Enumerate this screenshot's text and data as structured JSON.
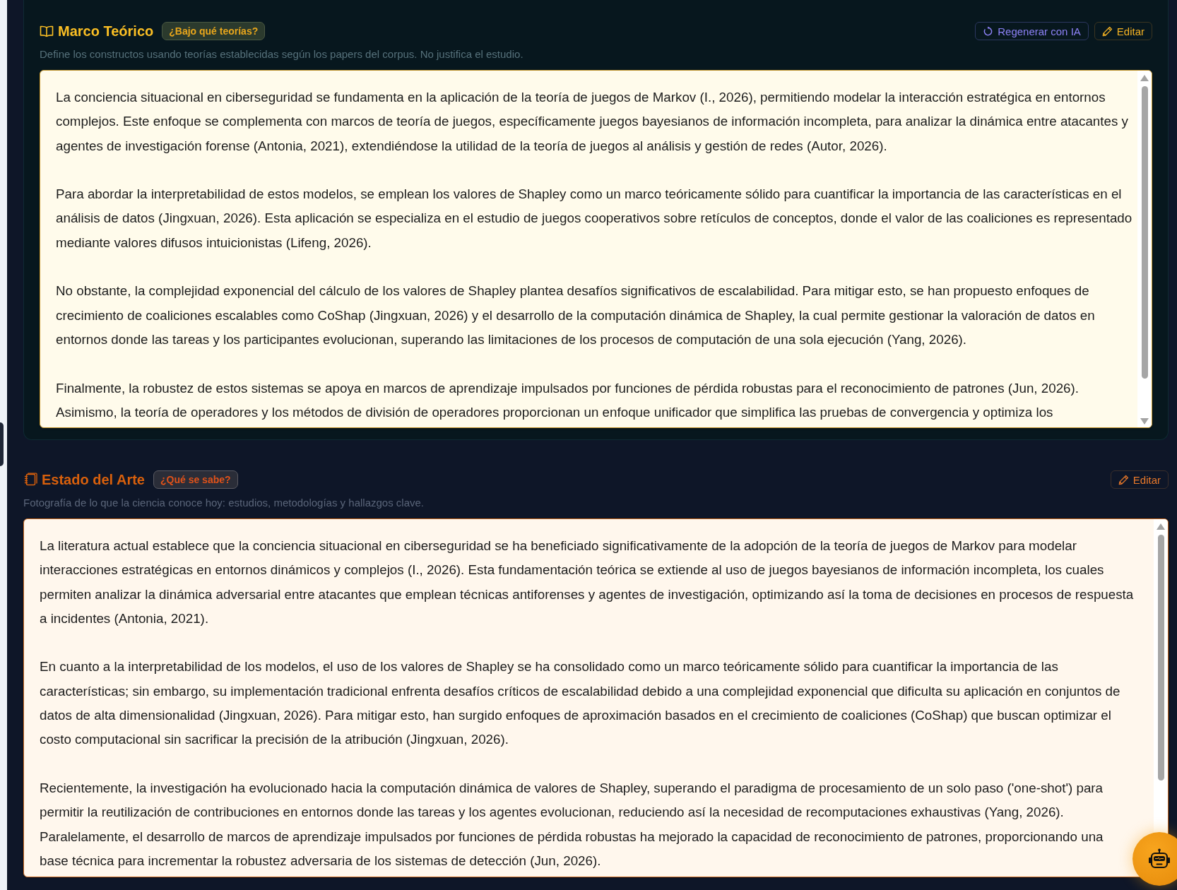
{
  "sections": [
    {
      "kind": "framework",
      "title": "Marco Teórico",
      "badge": "¿Bajo qué teorías?",
      "description": "Define los constructos usando teorías establecidas según los papers del corpus. No justifica el estudio.",
      "actions": [
        {
          "kind": "regenerate",
          "label": "Regenerar con IA"
        },
        {
          "kind": "edit",
          "label": "Editar"
        }
      ],
      "paragraphs": [
        "La conciencia situacional en ciberseguridad se fundamenta en la aplicación de la teoría de juegos de Markov (I., 2026), permitiendo modelar la interacción estratégica en entornos complejos. Este enfoque se complementa con marcos de teoría de juegos, específicamente juegos bayesianos de información incompleta, para analizar la dinámica entre atacantes y agentes de investigación forense (Antonia, 2021), extendiéndose la utilidad de la teoría de juegos al análisis y gestión de redes (Autor, 2026).",
        "Para abordar la interpretabilidad de estos modelos, se emplean los valores de Shapley como un marco teóricamente sólido para cuantificar la importancia de las características en el análisis de datos (Jingxuan, 2026). Esta aplicación se especializa en el estudio de juegos cooperativos sobre retículos de conceptos, donde el valor de las coaliciones es representado mediante valores difusos intuicionistas (Lifeng, 2026).",
        "No obstante, la complejidad exponencial del cálculo de los valores de Shapley plantea desafíos significativos de escalabilidad. Para mitigar esto, se han propuesto enfoques de crecimiento de coaliciones escalables como CoShap (Jingxuan, 2026) y el desarrollo de la computación dinámica de Shapley, la cual permite gestionar la valoración de datos en entornos donde las tareas y los participantes evolucionan, superando las limitaciones de los procesos de computación de una sola ejecución (Yang, 2026).",
        "Finalmente, la robustez de estos sistemas se apoya en marcos de aprendizaje impulsados por funciones de pérdida robustas para el reconocimiento de patrones (Jun, 2026). Asimismo, la teoría de operadores y los métodos de división de operadores proporcionan un enfoque unificador que simplifica las pruebas de convergencia y optimiza los"
      ]
    },
    {
      "kind": "review",
      "title": "Estado del Arte",
      "badge": "¿Qué se sabe?",
      "description": "Fotografía de lo que la ciencia conoce hoy: estudios, metodologías y hallazgos clave.",
      "actions": [
        {
          "kind": "edit",
          "label": "Editar"
        }
      ],
      "paragraphs": [
        "La literatura actual establece que la conciencia situacional en ciberseguridad se ha beneficiado significativamente de la adopción de la teoría de juegos de Markov para modelar interacciones estratégicas en entornos dinámicos y complejos (I., 2026). Esta fundamentación teórica se extiende al uso de juegos bayesianos de información incompleta, los cuales permiten analizar la dinámica adversarial entre atacantes que emplean técnicas antiforenses y agentes de investigación, optimizando así la toma de decisiones en procesos de respuesta a incidentes (Antonia, 2021).",
        "En cuanto a la interpretabilidad de los modelos, el uso de los valores de Shapley se ha consolidado como un marco teóricamente sólido para cuantificar la importancia de las características; sin embargo, su implementación tradicional enfrenta desafíos críticos de escalabilidad debido a una complejidad exponencial que dificulta su aplicación en conjuntos de datos de alta dimensionalidad (Jingxuan, 2026). Para mitigar esto, han surgido enfoques de aproximación basados en el crecimiento de coaliciones (CoShap) que buscan optimizar el costo computacional sin sacrificar la precisión de la atribución (Jingxuan, 2026).",
        "Recientemente, la investigación ha evolucionado hacia la computación dinámica de valores de Shapley, superando el paradigma de procesamiento de un solo paso ('one-shot') para permitir la reutilización de contribuciones en entornos donde las tareas y los agentes evolucionan, reduciendo así la necesidad de recomputaciones exhaustivas (Yang, 2026). Paralelamente, el desarrollo de marcos de aprendizaje impulsados por funciones de pérdida robustas ha mejorado la capacidad de reconocimiento de patrones, proporcionando una base técnica para incrementar la robustez adversaria de los sistemas de detección (Jun, 2026)."
      ]
    }
  ]
}
